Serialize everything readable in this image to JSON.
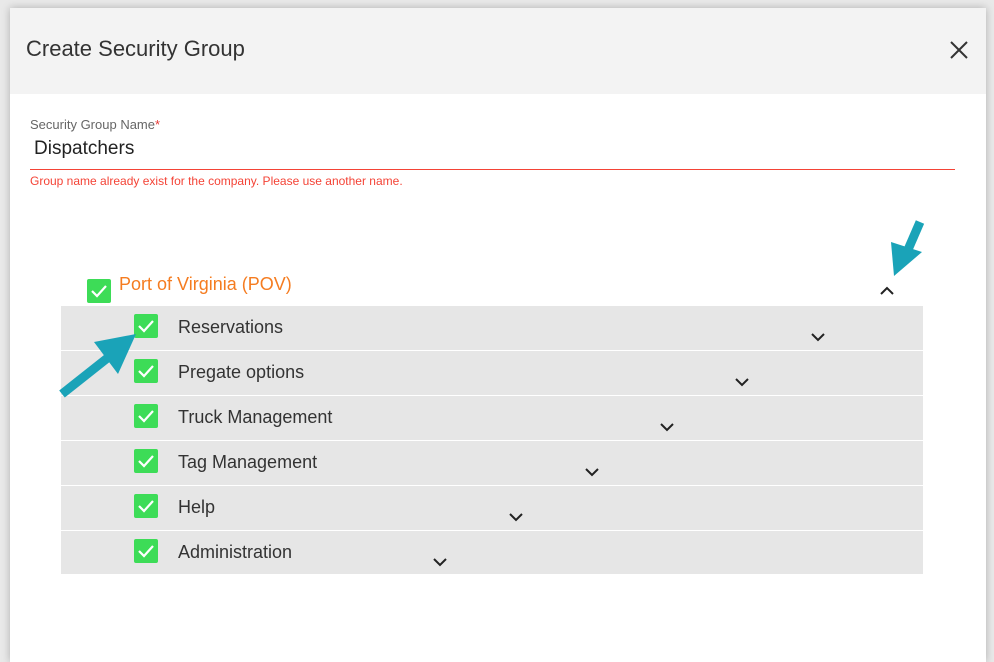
{
  "dialog": {
    "title": "Create Security Group",
    "close_icon": "close-icon"
  },
  "form": {
    "label": "Security Group Name",
    "required_mark": "*",
    "value": "Dispatchers",
    "error": "Group name already exist for the company. Please use another name."
  },
  "group": {
    "name": "Port of Virginia (POV)",
    "checked": true,
    "expanded": true,
    "items": [
      {
        "label": "Reservations",
        "checked": true
      },
      {
        "label": "Pregate options",
        "checked": true
      },
      {
        "label": "Truck Management",
        "checked": true
      },
      {
        "label": "Tag Management",
        "checked": true
      },
      {
        "label": "Help",
        "checked": true
      },
      {
        "label": "Administration",
        "checked": true
      }
    ]
  },
  "colors": {
    "checkbox": "#3ddc57",
    "group_label": "#f57c20",
    "error": "#f44336",
    "annotation_arrow": "#1aa3b8"
  }
}
